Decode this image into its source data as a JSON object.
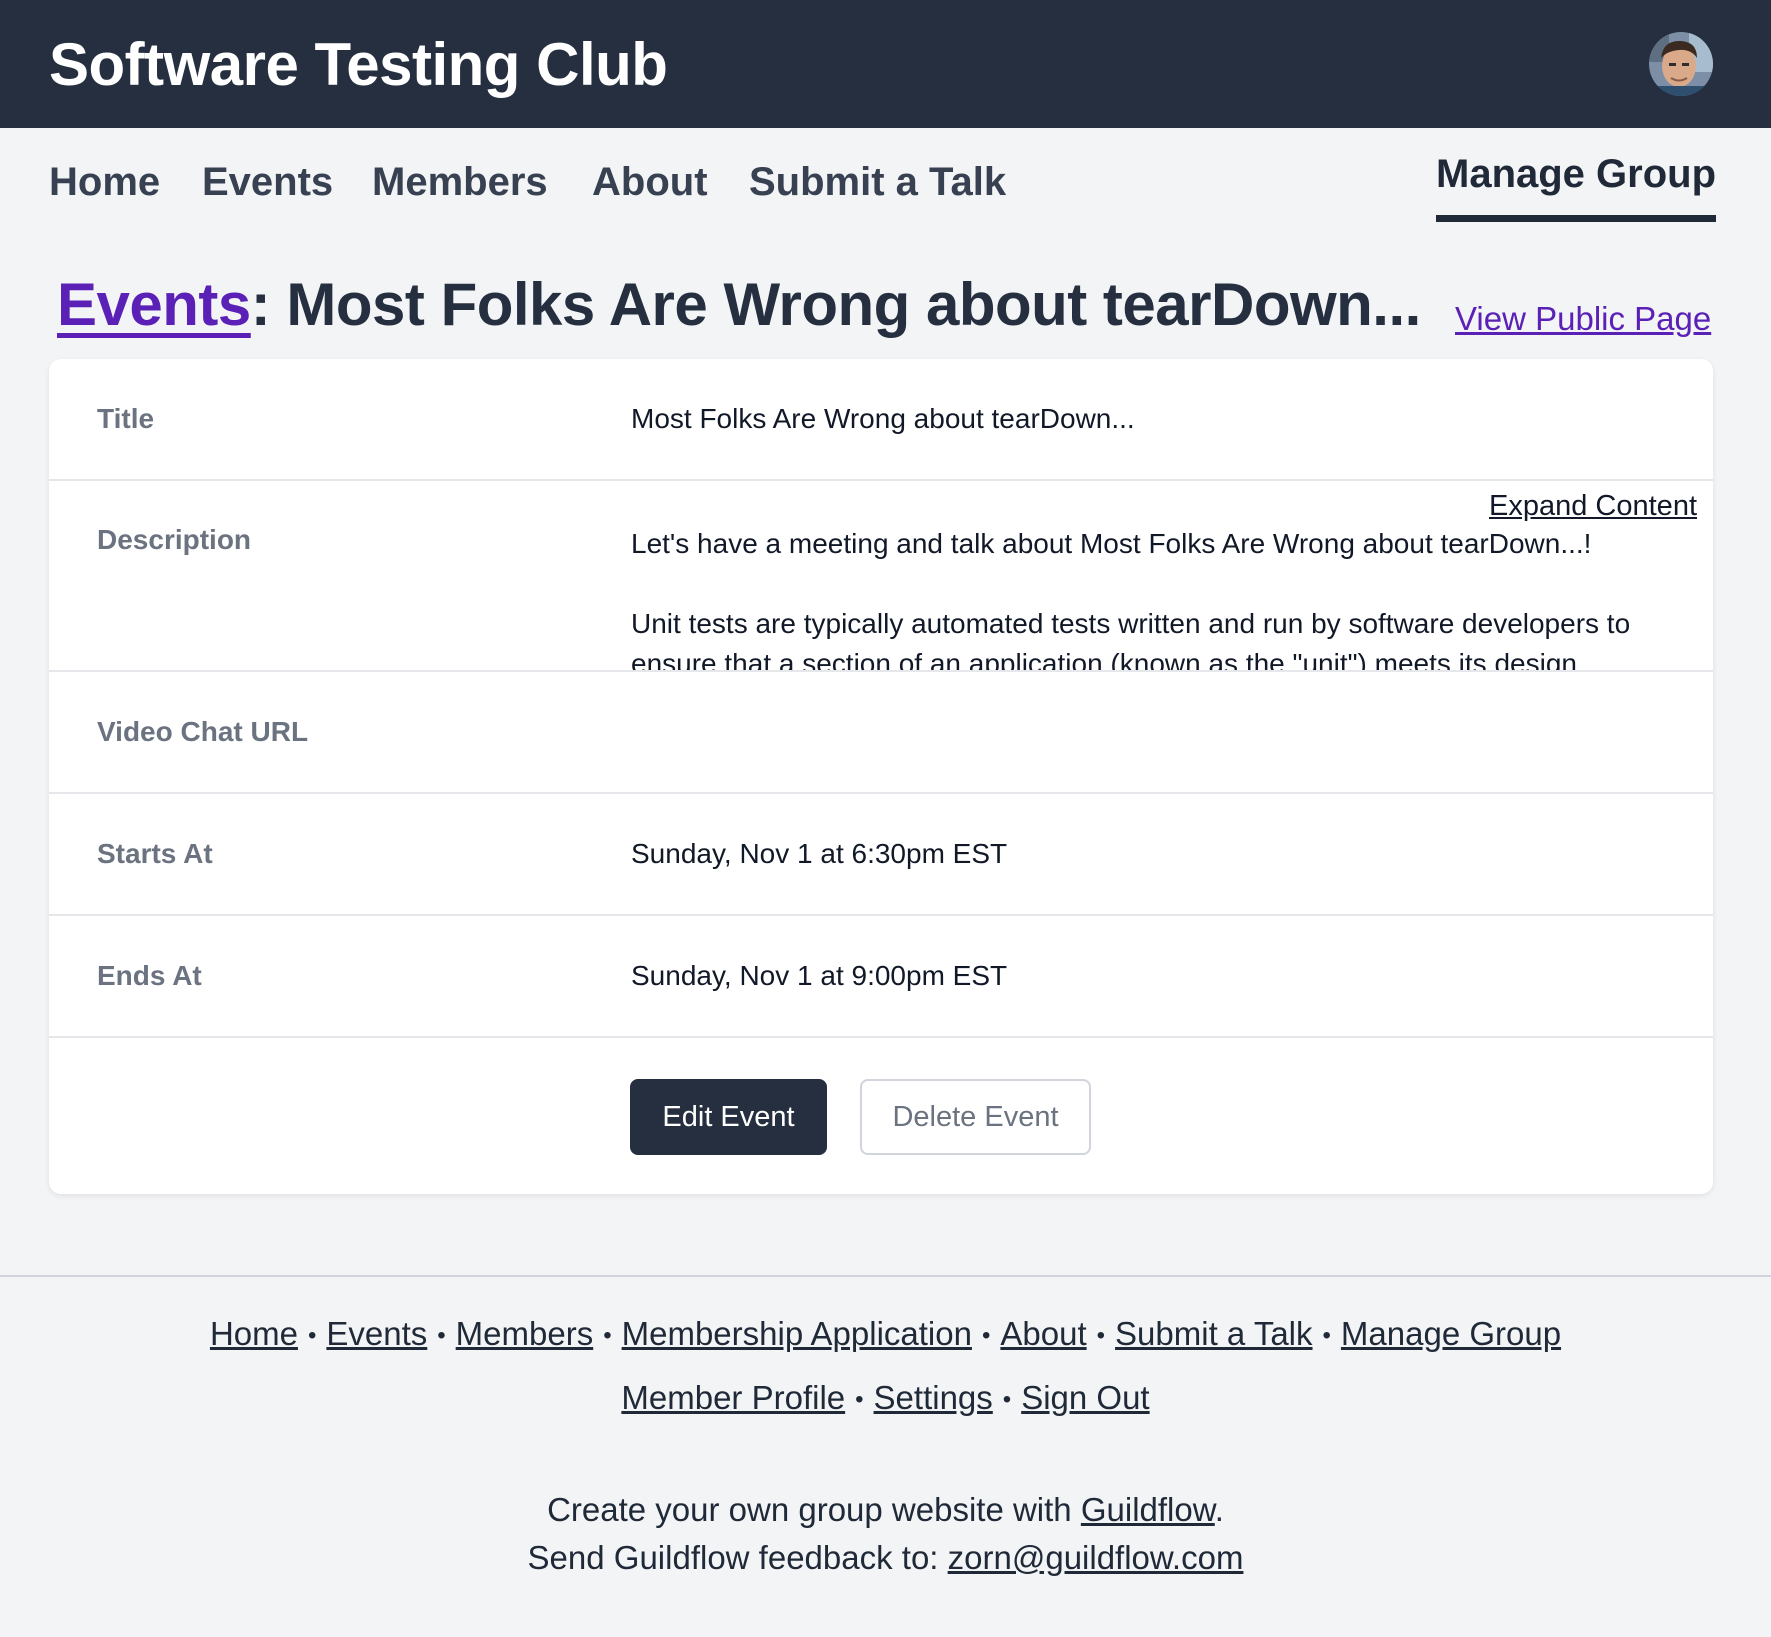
{
  "header": {
    "site_title": "Software Testing Club",
    "avatar_icon": "user-avatar-photo"
  },
  "nav": {
    "items": [
      "Home",
      "Events",
      "Members",
      "About",
      "Submit a Talk"
    ],
    "manage": "Manage Group"
  },
  "page": {
    "breadcrumb_link": "Events",
    "title_rest": ": Most Folks Are Wrong about tearDown...",
    "public_link": "View Public Page"
  },
  "details": {
    "title_label": "Title",
    "title_value": "Most Folks Are Wrong about tearDown...",
    "description_label": "Description",
    "expand_label": "Expand Content",
    "description_p1": "Let's have a meeting and talk about Most Folks Are Wrong about tearDown...!",
    "description_p2": "Unit tests are typically automated tests written and run by software developers to ensure that a section of an application (known as the \"unit\") meets its design",
    "video_label": "Video Chat URL",
    "video_value": "",
    "starts_label": "Starts At",
    "starts_value": "Sunday, Nov 1 at 6:30pm EST",
    "ends_label": "Ends At",
    "ends_value": "Sunday, Nov 1 at 9:00pm EST"
  },
  "actions": {
    "edit": "Edit Event",
    "delete": "Delete Event"
  },
  "footer": {
    "links_row1": [
      "Home",
      "Events",
      "Members",
      "Membership Application",
      "About",
      "Submit a Talk",
      "Manage Group"
    ],
    "links_row2": [
      "Member Profile",
      "Settings",
      "Sign Out"
    ],
    "separator": "•",
    "create_prefix": "Create your own group website with ",
    "create_link": "Guildflow",
    "create_suffix": ".",
    "feedback_prefix": "Send Guildflow feedback to: ",
    "feedback_email": "zorn@guildflow.com"
  },
  "colors": {
    "header_bg": "#252f3f",
    "link_purple": "#5b21b6",
    "page_bg": "#f3f4f6"
  }
}
